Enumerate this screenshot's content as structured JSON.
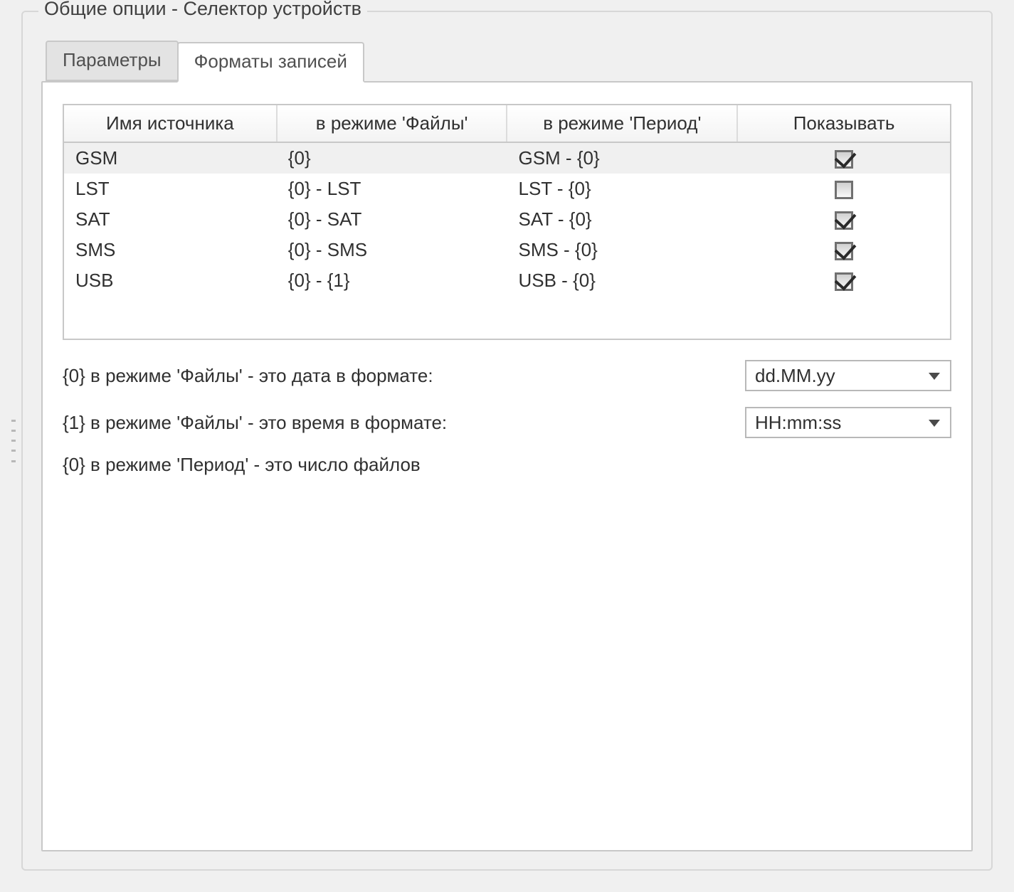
{
  "group_title": "Общие опции - Селектор устройств",
  "tabs": {
    "params": "Параметры",
    "formats": "Форматы записей"
  },
  "grid": {
    "columns": {
      "source": "Имя источника",
      "files_mode": "в режиме 'Файлы'",
      "period_mode": "в режиме 'Период'",
      "show": "Показывать"
    },
    "rows": [
      {
        "source": "GSM",
        "files": "{0}",
        "period": "GSM - {0}",
        "show": true
      },
      {
        "source": "LST",
        "files": "{0} - LST",
        "period": "LST - {0}",
        "show": false
      },
      {
        "source": "SAT",
        "files": "{0} - SAT",
        "period": "SAT - {0}",
        "show": true
      },
      {
        "source": "SMS",
        "files": "{0} - SMS",
        "period": "SMS - {0}",
        "show": true
      },
      {
        "source": "USB",
        "files": "{0} - {1}",
        "period": "USB - {0}",
        "show": true
      }
    ]
  },
  "notes": {
    "line1": "{0} в режиме 'Файлы' - это дата в формате:",
    "line2": "{1} в режиме 'Файлы' - это время в формате:",
    "line3": "{0} в режиме 'Период' - это число файлов"
  },
  "combos": {
    "date_format": "dd.MM.yy",
    "time_format": "HH:mm:ss"
  }
}
